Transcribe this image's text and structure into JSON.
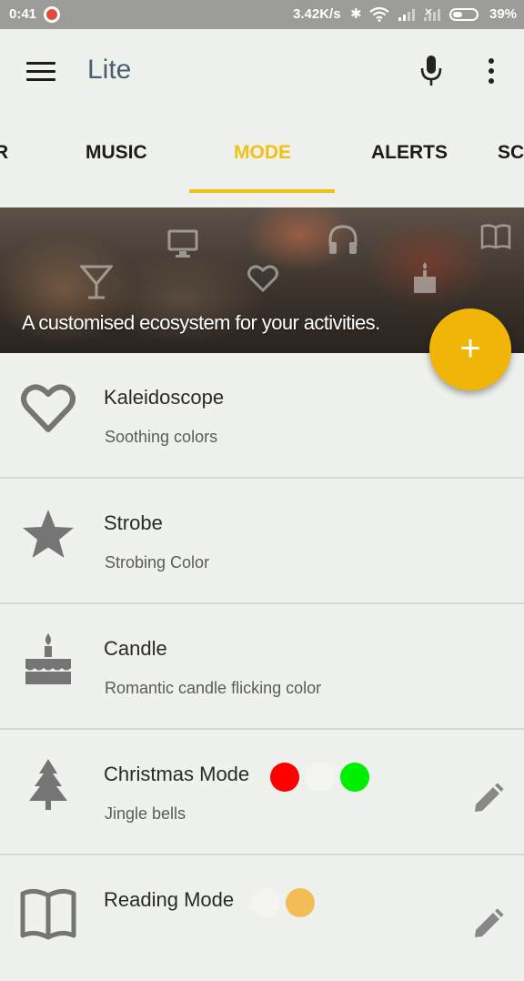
{
  "status_bar": {
    "time": "0:41",
    "network_speed": "3.42K/s",
    "battery": "39%"
  },
  "app_bar": {
    "title": "Lite"
  },
  "tabs": [
    {
      "label": "R",
      "active": false
    },
    {
      "label": "MUSIC",
      "active": false
    },
    {
      "label": "MODE",
      "active": true
    },
    {
      "label": "ALERTS",
      "active": false
    },
    {
      "label": "SC",
      "active": false
    }
  ],
  "banner": {
    "text": "A customised ecosystem for your activities."
  },
  "fab": {
    "label": "+"
  },
  "modes": [
    {
      "title": "Kaleidoscope",
      "subtitle": "Soothing colors",
      "icon": "heart-icon",
      "colors": []
    },
    {
      "title": "Strobe",
      "subtitle": "Strobing Color",
      "icon": "star-icon",
      "colors": []
    },
    {
      "title": "Candle",
      "subtitle": "Romantic candle flicking color",
      "icon": "cake-icon",
      "colors": []
    },
    {
      "title": "Christmas Mode",
      "subtitle": "Jingle bells",
      "icon": "tree-icon",
      "colors": [
        "#ff0000",
        "#f4f5f2",
        "#00ee00"
      ]
    },
    {
      "title": "Reading Mode",
      "subtitle": "",
      "icon": "book-icon",
      "colors": [
        "#f4f5f2",
        "#f3bd55"
      ]
    }
  ],
  "colors": {
    "accent": "#f0c117",
    "fab": "#f1b507",
    "title": "#4a5d73",
    "background": "#eff1ec"
  }
}
